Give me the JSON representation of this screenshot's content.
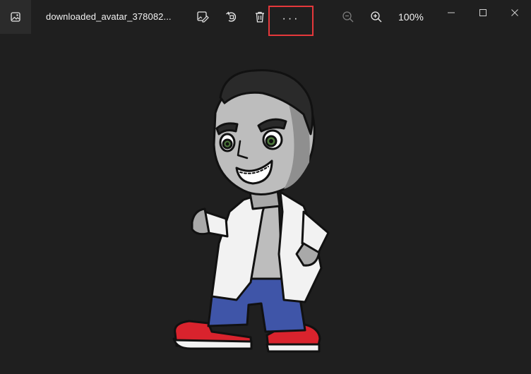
{
  "app": {
    "icon": "photos-app-icon"
  },
  "toolbar": {
    "filename": "downloaded_avatar_378082...",
    "edit_icon": "edit-image-icon",
    "rotate_icon": "rotate-icon",
    "delete_icon": "delete-trash-icon",
    "more_label": "···",
    "zoom_out_icon": "zoom-out-icon",
    "zoom_in_icon": "zoom-in-icon",
    "zoom_level": "100%"
  },
  "window_controls": {
    "minimize_icon": "minimize-icon",
    "maximize_icon": "maximize-icon",
    "close_icon": "close-icon"
  },
  "colors": {
    "background": "#1f1f1f",
    "highlight": "#e5383b",
    "shoe_red": "#d9232d",
    "jeans_blue": "#3f55a8",
    "skin_gray": "#a9a9a9",
    "coat_white": "#f2f2f2"
  }
}
